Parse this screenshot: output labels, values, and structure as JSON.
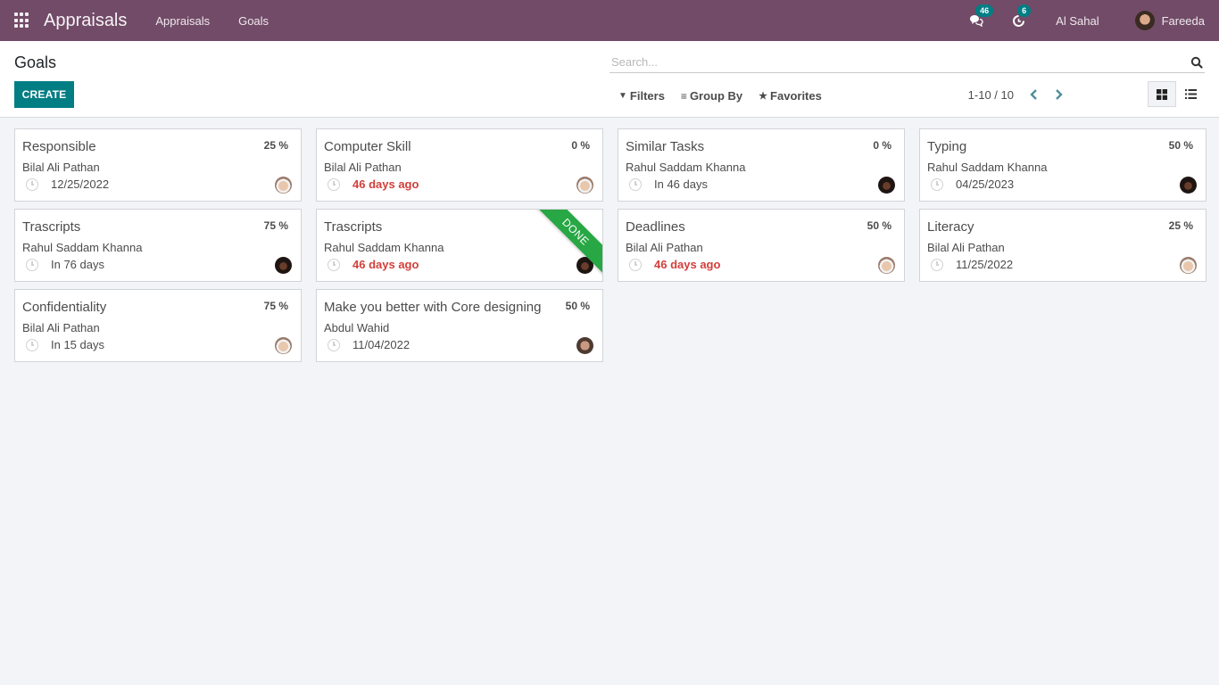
{
  "navbar": {
    "app_name": "Appraisals",
    "menu": [
      "Appraisals",
      "Goals"
    ],
    "messages_count": "46",
    "activities_count": "6",
    "company": "Al Sahal",
    "user": "Fareeda",
    "bg_color": "#714b67"
  },
  "control_panel": {
    "title": "Goals",
    "create_label": "CREATE",
    "search_placeholder": "Search...",
    "filters_label": "Filters",
    "group_by_label": "Group By",
    "favorites_label": "Favorites",
    "pager": "1-10 / 10"
  },
  "cards": [
    {
      "title": "Responsible",
      "progress": "25 %",
      "employee": "Bilal Ali Pathan",
      "deadline": "12/25/2022",
      "overdue": false,
      "avatar": "bilal"
    },
    {
      "title": "Computer Skill",
      "progress": "0 %",
      "employee": "Bilal Ali Pathan",
      "deadline": "46 days ago",
      "overdue": true,
      "avatar": "bilal"
    },
    {
      "title": "Similar Tasks",
      "progress": "0 %",
      "employee": "Rahul Saddam Khanna",
      "deadline": "In 46 days",
      "overdue": false,
      "avatar": "rahul"
    },
    {
      "title": "Typing",
      "progress": "50 %",
      "employee": "Rahul Saddam Khanna",
      "deadline": "04/25/2023",
      "overdue": false,
      "avatar": "rahul"
    },
    {
      "title": "Trascripts",
      "progress": "75 %",
      "employee": "Rahul Saddam Khanna",
      "deadline": "In 76 days",
      "overdue": false,
      "avatar": "rahul"
    },
    {
      "title": "Trascripts",
      "progress": "",
      "employee": "Rahul Saddam Khanna",
      "deadline": "46 days ago",
      "overdue": true,
      "avatar": "rahul",
      "ribbon": "DONE"
    },
    {
      "title": "Deadlines",
      "progress": "50 %",
      "employee": "Bilal Ali Pathan",
      "deadline": "46 days ago",
      "overdue": true,
      "avatar": "bilal"
    },
    {
      "title": "Literacy",
      "progress": "25 %",
      "employee": "Bilal Ali Pathan",
      "deadline": "11/25/2022",
      "overdue": false,
      "avatar": "bilal"
    },
    {
      "title": "Confidentiality",
      "progress": "75 %",
      "employee": "Bilal Ali Pathan",
      "deadline": "In 15 days",
      "overdue": false,
      "avatar": "bilal"
    },
    {
      "title": "Make you better with Core designing",
      "progress": "50 %",
      "employee": "Abdul Wahid",
      "deadline": "11/04/2022",
      "overdue": false,
      "avatar": "abdul"
    }
  ]
}
